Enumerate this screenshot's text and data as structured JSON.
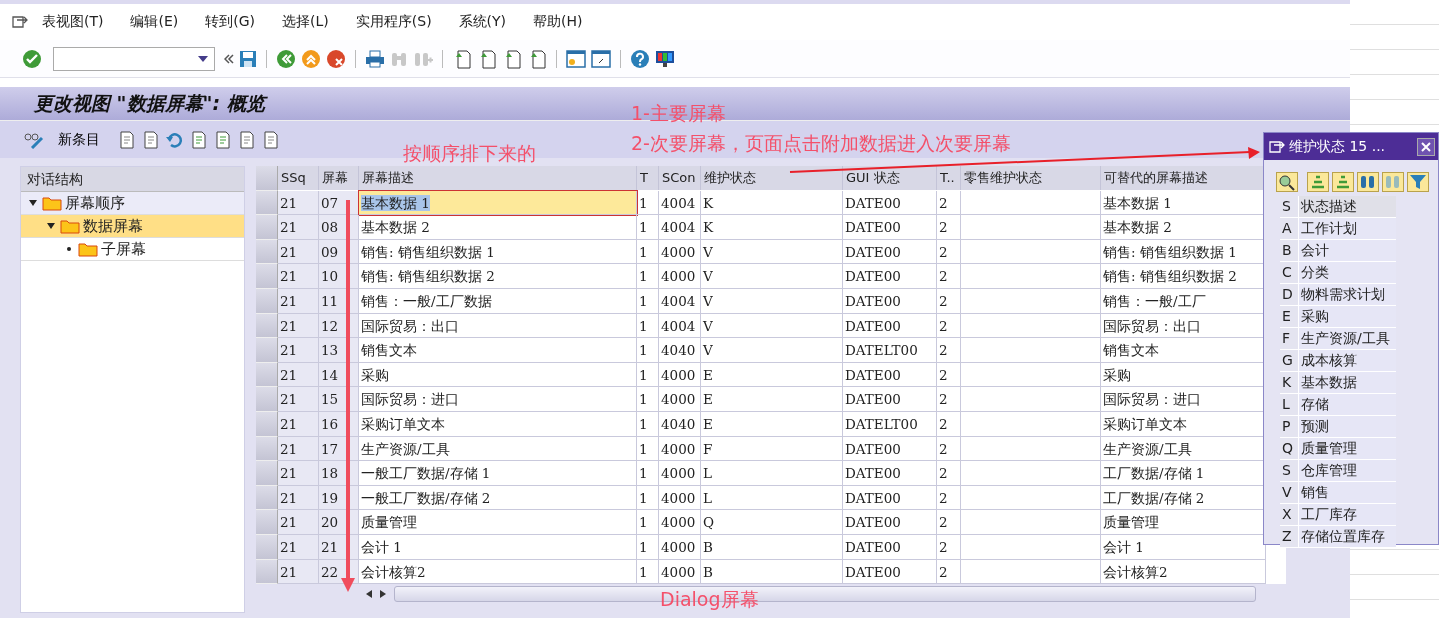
{
  "menu": [
    "表视图(T)",
    "编辑(E)",
    "转到(G)",
    "选择(L)",
    "实用程序(S)",
    "系统(Y)",
    "帮助(H)"
  ],
  "title": "更改视图 \"数据屏幕\": 概览",
  "app_toolbar": {
    "new_entry": "新条目"
  },
  "tree": {
    "header": "对话结构",
    "items": [
      {
        "label": "屏幕顺序",
        "expanded": true,
        "selected": false,
        "children": [
          {
            "label": "数据屏幕",
            "expanded": true,
            "selected": true,
            "children": [
              {
                "label": "子屏幕",
                "expanded": false,
                "selected": false
              }
            ]
          }
        ]
      }
    ]
  },
  "table": {
    "columns": [
      "SSq",
      "屏幕",
      "屏幕描述",
      "T",
      "SCon",
      "维护状态",
      "GUI 状态",
      "T..",
      "零售维护状态",
      "可替代的屏幕描述"
    ],
    "rows": [
      {
        "cells": [
          "21",
          "07",
          "基本数据 1",
          "1",
          "4004",
          "K",
          "DATE00",
          "2",
          "",
          "基本数据 1"
        ],
        "selected": true
      },
      {
        "cells": [
          "21",
          "08",
          "基本数据 2",
          "1",
          "4004",
          "K",
          "DATE00",
          "2",
          "",
          "基本数据 2"
        ],
        "selected": false
      },
      {
        "cells": [
          "21",
          "09",
          "销售: 销售组织数据 1",
          "1",
          "4000",
          "V",
          "DATE00",
          "2",
          "",
          "销售: 销售组织数据 1"
        ],
        "selected": false
      },
      {
        "cells": [
          "21",
          "10",
          "销售: 销售组织数据 2",
          "1",
          "4000",
          "V",
          "DATE00",
          "2",
          "",
          "销售: 销售组织数据 2"
        ],
        "selected": false
      },
      {
        "cells": [
          "21",
          "11",
          "销售：一般/工厂数据",
          "1",
          "4004",
          "V",
          "DATE00",
          "2",
          "",
          "销售：一般/工厂"
        ],
        "selected": false
      },
      {
        "cells": [
          "21",
          "12",
          "国际贸易：出口",
          "1",
          "4004",
          "V",
          "DATE00",
          "2",
          "",
          "国际贸易：出口"
        ],
        "selected": false
      },
      {
        "cells": [
          "21",
          "13",
          "销售文本",
          "1",
          "4040",
          "V",
          "DATELT00",
          "2",
          "",
          "销售文本"
        ],
        "selected": false
      },
      {
        "cells": [
          "21",
          "14",
          "采购",
          "1",
          "4000",
          "E",
          "DATE00",
          "2",
          "",
          "采购"
        ],
        "selected": false
      },
      {
        "cells": [
          "21",
          "15",
          "国际贸易：进口",
          "1",
          "4000",
          "E",
          "DATE00",
          "2",
          "",
          "国际贸易：进口"
        ],
        "selected": false
      },
      {
        "cells": [
          "21",
          "16",
          "采购订单文本",
          "1",
          "4040",
          "E",
          "DATELT00",
          "2",
          "",
          "采购订单文本"
        ],
        "selected": false
      },
      {
        "cells": [
          "21",
          "17",
          "生产资源/工具",
          "1",
          "4000",
          "F",
          "DATE00",
          "2",
          "",
          "生产资源/工具"
        ],
        "selected": false
      },
      {
        "cells": [
          "21",
          "18",
          "一般工厂数据/存储 1",
          "1",
          "4000",
          "L",
          "DATE00",
          "2",
          "",
          "工厂数据/存储 1"
        ],
        "selected": false
      },
      {
        "cells": [
          "21",
          "19",
          "一般工厂数据/存储 2",
          "1",
          "4000",
          "L",
          "DATE00",
          "2",
          "",
          "工厂数据/存储 2"
        ],
        "selected": false
      },
      {
        "cells": [
          "21",
          "20",
          "质量管理",
          "1",
          "4000",
          "Q",
          "DATE00",
          "2",
          "",
          "质量管理"
        ],
        "selected": false
      },
      {
        "cells": [
          "21",
          "21",
          "会计 1",
          "1",
          "4000",
          "B",
          "DATE00",
          "2",
          "",
          "会计 1"
        ],
        "selected": false
      },
      {
        "cells": [
          "21",
          "22",
          "会计核算2",
          "1",
          "4000",
          "B",
          "DATE00",
          "2",
          "",
          "会计核算2"
        ],
        "selected": false
      }
    ]
  },
  "popup": {
    "title": "维护状态 15 ...",
    "columns": [
      "S",
      "状态描述"
    ],
    "rows": [
      [
        "A",
        "工作计划"
      ],
      [
        "B",
        "会计"
      ],
      [
        "C",
        "分类"
      ],
      [
        "D",
        "物料需求计划"
      ],
      [
        "E",
        "采购"
      ],
      [
        "F",
        "生产资源/工具"
      ],
      [
        "G",
        "成本核算"
      ],
      [
        "K",
        "基本数据"
      ],
      [
        "L",
        "存储"
      ],
      [
        "P",
        "预测"
      ],
      [
        "Q",
        "质量管理"
      ],
      [
        "S",
        "仓库管理"
      ],
      [
        "V",
        "销售"
      ],
      [
        "X",
        "工厂库存"
      ],
      [
        "Z",
        "存储位置库存"
      ]
    ]
  },
  "annotations": [
    {
      "kind": "order",
      "text": "按顺序排下来的"
    },
    {
      "kind": "main",
      "text": "1-主要屏幕"
    },
    {
      "kind": "sub",
      "text": "2-次要屏幕，页面点击附加数据进入次要屏幕"
    },
    {
      "kind": "dialog",
      "text": "Dialog屏幕"
    }
  ]
}
